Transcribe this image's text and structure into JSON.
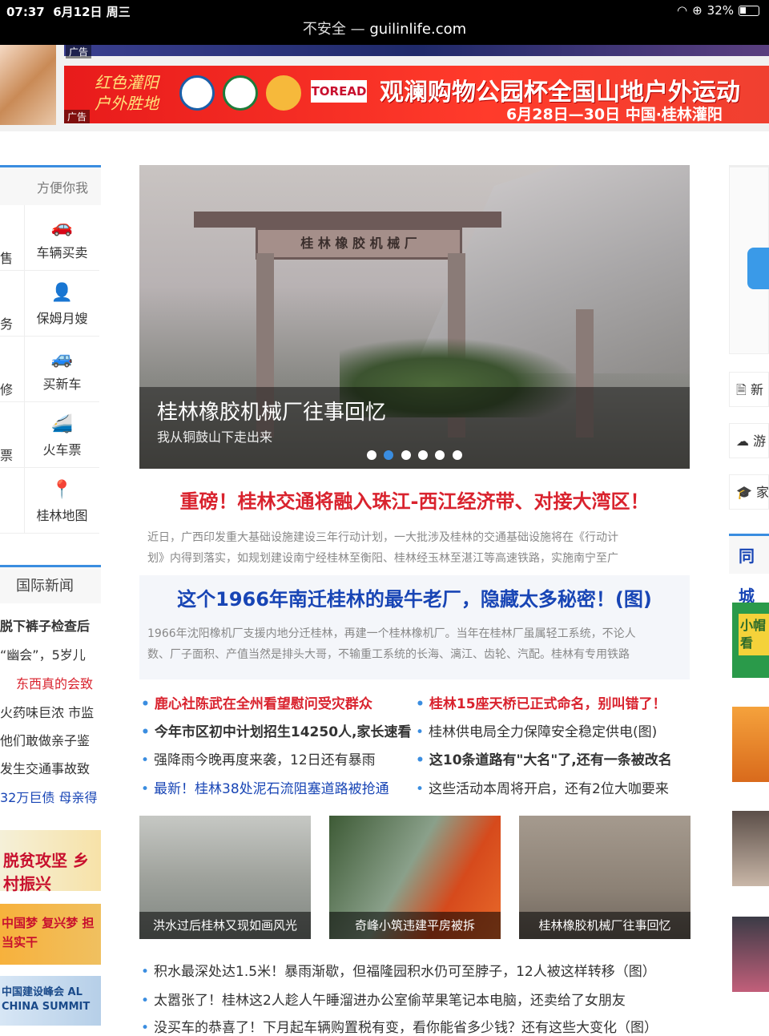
{
  "status_bar": {
    "time": "07:37",
    "date": "6月12日 周三",
    "battery": "32%"
  },
  "browser": {
    "security": "不安全 —",
    "domain": "guilinlife.com"
  },
  "ads": {
    "tag": "广告",
    "banner_slogan_line1": "红色灌阳",
    "banner_slogan_line2": "户外胜地",
    "banner_brand": "TOREAD",
    "banner_headline": "观澜购物公园杯全国山地户外运动",
    "banner_date": "6月28日—30日 中国·桂林灌阳"
  },
  "left_sidebar": {
    "convenience_title": "方便你我",
    "services": [
      {
        "cut": "售",
        "label": "车辆买卖",
        "icon": "car-icon"
      },
      {
        "cut": "务",
        "label": "保姆月嫂",
        "icon": "nanny-icon"
      },
      {
        "cut": "修",
        "label": "买新车",
        "icon": "new-car-icon"
      },
      {
        "cut": "票",
        "label": "火车票",
        "icon": "train-icon"
      },
      {
        "cut": "",
        "label": "桂林地图",
        "icon": "map-pin-icon"
      }
    ],
    "intl_news_title": "国际新闻",
    "news": [
      {
        "text": "脱下裤子检查后",
        "style": "bold"
      },
      {
        "text": "“幽会”，5岁儿",
        "style": "normal"
      },
      {
        "text": "东西真的会致",
        "style": "red"
      },
      {
        "text": "火药味巨浓 市监",
        "style": "normal"
      },
      {
        "text": "他们敢做亲子鉴",
        "style": "normal"
      },
      {
        "text": "发生交通事故致",
        "style": "normal"
      },
      {
        "text": "32万巨债 母亲得",
        "style": "blue"
      }
    ],
    "ad_texts": [
      "脱贫攻坚 乡村振兴",
      "中国梦 复兴梦 担当实干",
      "中国建设峰会 AL CHINA SUMMIT"
    ]
  },
  "carousel": {
    "title": "桂林橡胶机械厂往事回忆",
    "subtitle": "我从铜鼓山下走出来",
    "plaque": "桂 林 橡 胶 机 械 厂",
    "dots": 6,
    "active_dot": 1
  },
  "main": {
    "headline1": "重磅！桂林交通将融入珠江-西江经济带、对接大湾区！",
    "summary1_line1": "近日，广西印发重大基础设施建设三年行动计划，一大批涉及桂林的交通基础设施将在《行动计",
    "summary1_line2": "划》内得到落实，如规划建设南宁经桂林至衡阳、桂林经玉林至湛江等高速铁路，实施南宁至广",
    "headline2": "这个1966年南迁桂林的最牛老厂，隐藏太多秘密！(图)",
    "summary2_line1": "1966年沈阳橡机厂支援内地分迁桂林，再建一个桂林橡机厂。当年在桂林厂虽属轻工系统，不论人",
    "summary2_line2": "数、厂子面积、产值当然是排头大哥，不输重工系统的长海、漓江、齿轮、汽配。桂林有专用铁路",
    "news_left": [
      {
        "text": "鹿心社陈武在全州看望慰问受灾群众",
        "style": "red bold"
      },
      {
        "text": "今年市区初中计划招生14250人,家长速看",
        "style": "bold"
      },
      {
        "text": "强降雨今晚再度来袭，12日还有暴雨",
        "style": ""
      },
      {
        "text": "最新！桂林38处泥石流阻塞道路被抢通",
        "style": "blue"
      }
    ],
    "news_right": [
      {
        "text": "桂林15座天桥已正式命名，别叫错了！",
        "style": "red bold"
      },
      {
        "text": "桂林供电局全力保障安全稳定供电(图)",
        "style": ""
      },
      {
        "text": "这10条道路有\"大名\"了,还有一条被改名",
        "style": "bold"
      },
      {
        "text": "这些活动本周将开启，还有2位大咖要来",
        "style": ""
      }
    ],
    "thumbs": [
      "洪水过后桂林又现如画风光",
      "奇峰小筑违建平房被拆",
      "桂林橡胶机械厂往事回忆"
    ],
    "bottom_news": [
      "积水最深处达1.5米！暴雨渐歇，但福隆园积水仍可至脖子，12人被这样转移（图）",
      "太嚣张了！桂林这2人趁人午睡溜进办公室偷苹果笔记本电脑，还卖给了女朋友",
      "没买车的恭喜了！下月起车辆购置税有变，看你能省多少钱？还有这些大变化（图）"
    ]
  },
  "right_sidebar": {
    "links": [
      {
        "label": "新",
        "icon": "doc-icon"
      },
      {
        "label": "游",
        "icon": "cloud-icon"
      },
      {
        "label": "家",
        "icon": "cap-icon"
      }
    ],
    "section_title": "同城",
    "ad1_text": "小帽 看"
  },
  "colors": {
    "accent": "#3a8de0",
    "red": "#d9232e",
    "blue": "#1845b5"
  }
}
